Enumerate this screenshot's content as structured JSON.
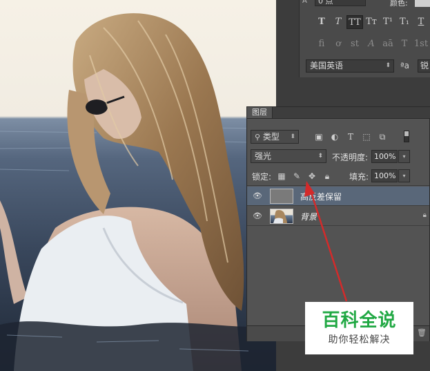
{
  "character_panel": {
    "leading_value": "0 点",
    "color_label": "颜色:",
    "color_swatch": "#cfcfcf",
    "style_buttons": [
      "T",
      "T",
      "TT",
      "Tт",
      "T¹",
      "T₁",
      "T"
    ],
    "opentype_buttons": [
      "fi",
      "ơ",
      "st",
      "A",
      "aā",
      "T",
      "1st"
    ],
    "language": "美国英语",
    "aa_label": "ªa",
    "antialias": "锐"
  },
  "layers_panel": {
    "tab_label": "图层",
    "filter_label": "类型",
    "blend_mode": "强光",
    "opacity_label": "不透明度:",
    "opacity_value": "100%",
    "lock_label": "锁定:",
    "fill_label": "填充:",
    "fill_value": "100%",
    "layers": [
      {
        "name": "高反差保留",
        "selected": true,
        "thumb_color": "#7a7a7a",
        "locked": false
      },
      {
        "name": "背景",
        "selected": false,
        "thumb_color": "photo",
        "locked": true
      }
    ]
  },
  "watermark": {
    "title": "百科全说",
    "subtitle": "助你轻松解决",
    "title_color": "#20a843"
  },
  "annotation": {
    "arrow_color": "#d42a2a"
  }
}
